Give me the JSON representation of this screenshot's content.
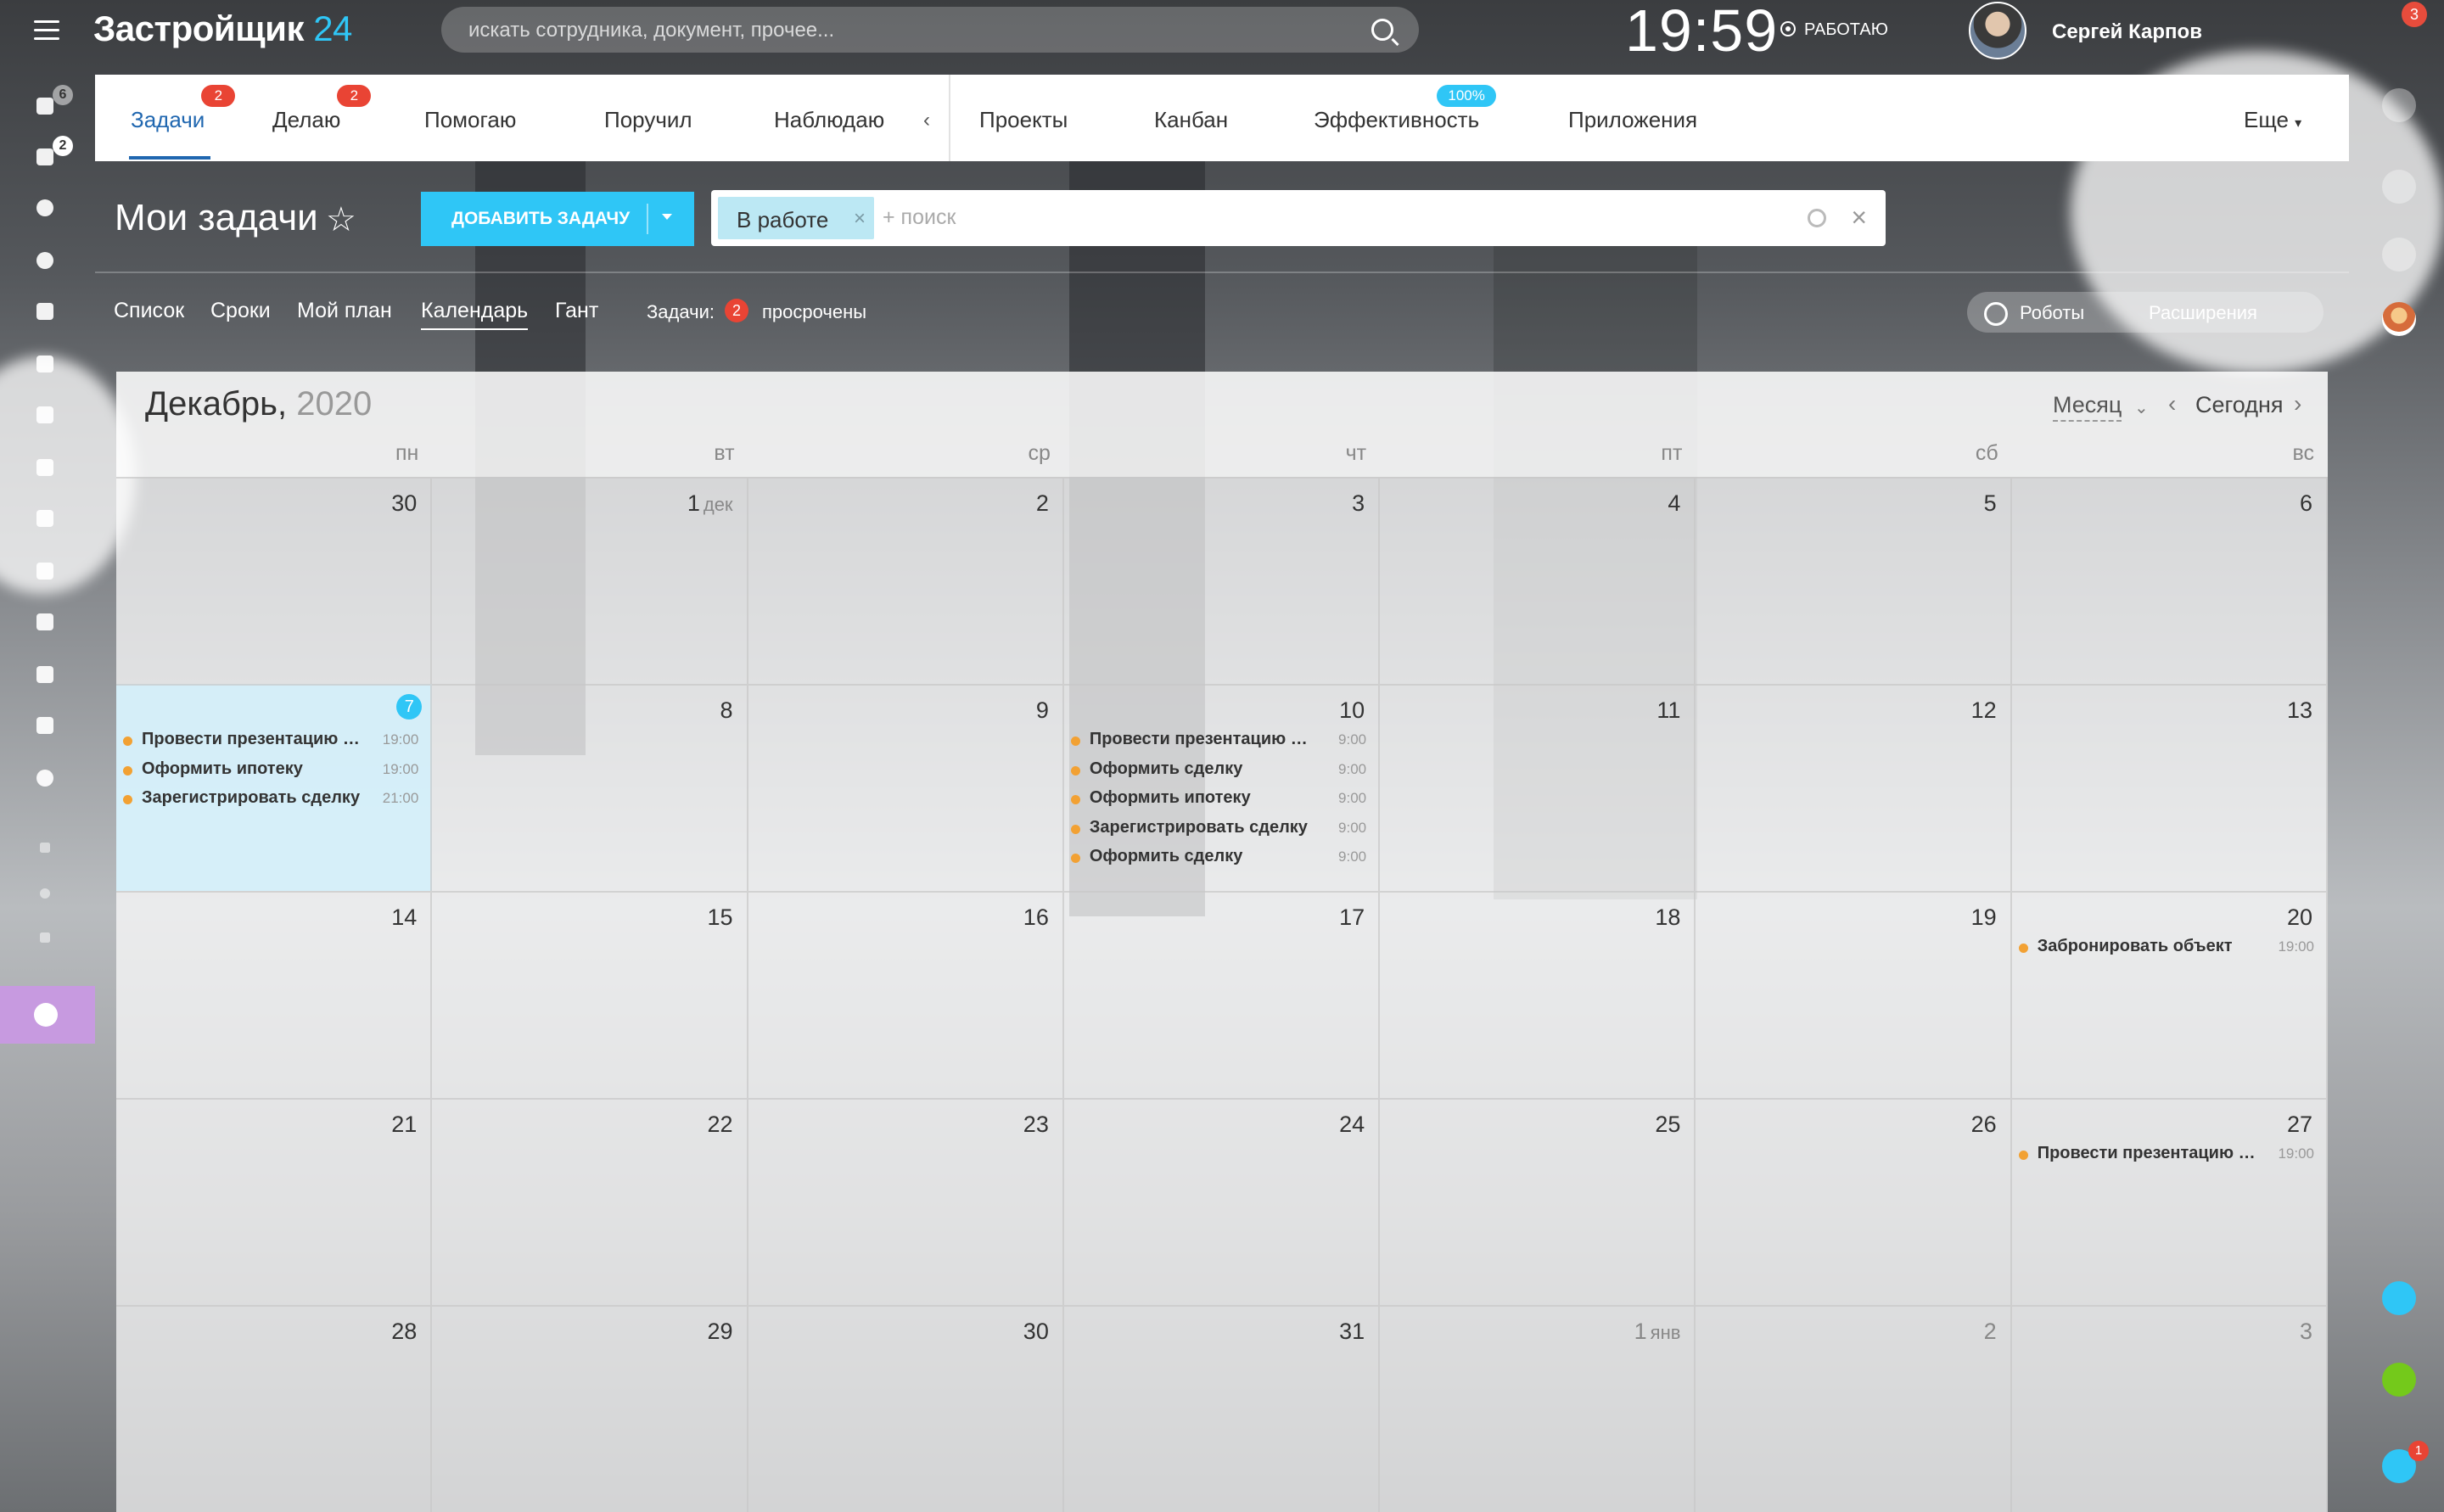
{
  "header": {
    "logo_main": "Застройщик",
    "logo_num": "24",
    "search_placeholder": "искать сотрудника, документ, прочее...",
    "clock": "19:59",
    "work_status": "РАБОТАЮ",
    "user_name": "Сергей Карпов",
    "notifications": "3"
  },
  "sidebar": {
    "badges": {
      "stream": "6",
      "tasks": "2"
    }
  },
  "tabs": [
    {
      "label": "Задачи",
      "badge": "2"
    },
    {
      "label": "Делаю",
      "badge": "2"
    },
    {
      "label": "Помогаю"
    },
    {
      "label": "Поручил"
    },
    {
      "label": "Наблюдаю"
    },
    {
      "label": "Проекты"
    },
    {
      "label": "Канбан"
    },
    {
      "label": "Эффективность",
      "badge": "100%"
    },
    {
      "label": "Приложения"
    },
    {
      "label": "Еще"
    }
  ],
  "toolbar": {
    "page_title": "Мои задачи",
    "add_button": "ДОБАВИТЬ ЗАДАЧУ",
    "filter_chip": "В работе",
    "filter_placeholder": "+ поиск"
  },
  "views": {
    "items": [
      "Список",
      "Сроки",
      "Мой план",
      "Календарь",
      "Гант"
    ],
    "counter_label": "Задачи:",
    "counter_value": "2",
    "counter_text": "просрочены",
    "robots": "Роботы",
    "extensions": "Расширения"
  },
  "calendar": {
    "month": "Декабрь,",
    "year": "2020",
    "mode": "Месяц",
    "today_label": "Сегодня",
    "weekdays": [
      "пн",
      "вт",
      "ср",
      "чт",
      "пт",
      "сб",
      "вс"
    ],
    "weeks": [
      [
        {
          "d": "30"
        },
        {
          "d": "1",
          "m": "дек"
        },
        {
          "d": "2"
        },
        {
          "d": "3"
        },
        {
          "d": "4"
        },
        {
          "d": "5"
        },
        {
          "d": "6"
        }
      ],
      [
        {
          "d": "7",
          "today": true,
          "events": [
            {
              "name": "Провести презентацию о...",
              "time": "19:00"
            },
            {
              "name": "Оформить ипотеку",
              "time": "19:00"
            },
            {
              "name": "Зарегистрировать сделку",
              "time": "21:00"
            }
          ]
        },
        {
          "d": "8"
        },
        {
          "d": "9"
        },
        {
          "d": "10",
          "events": [
            {
              "name": "Провести презентацию он...",
              "time": "9:00"
            },
            {
              "name": "Оформить сделку",
              "time": "9:00"
            },
            {
              "name": "Оформить ипотеку",
              "time": "9:00"
            },
            {
              "name": "Зарегистрировать сделку",
              "time": "9:00"
            },
            {
              "name": "Оформить сделку",
              "time": "9:00"
            }
          ]
        },
        {
          "d": "11"
        },
        {
          "d": "12"
        },
        {
          "d": "13"
        }
      ],
      [
        {
          "d": "14"
        },
        {
          "d": "15"
        },
        {
          "d": "16"
        },
        {
          "d": "17"
        },
        {
          "d": "18"
        },
        {
          "d": "19"
        },
        {
          "d": "20",
          "events": [
            {
              "name": "Забронировать объект",
              "time": "19:00"
            }
          ]
        }
      ],
      [
        {
          "d": "21"
        },
        {
          "d": "22"
        },
        {
          "d": "23"
        },
        {
          "d": "24"
        },
        {
          "d": "25"
        },
        {
          "d": "26"
        },
        {
          "d": "27",
          "events": [
            {
              "name": "Провести презентацию о...",
              "time": "19:00"
            }
          ]
        }
      ],
      [
        {
          "d": "28"
        },
        {
          "d": "29"
        },
        {
          "d": "30"
        },
        {
          "d": "31"
        },
        {
          "d": "1",
          "m": "янв",
          "other": true
        },
        {
          "d": "2",
          "other": true
        },
        {
          "d": "3",
          "other": true
        }
      ]
    ]
  },
  "rightbar": {
    "edu_badge": "1"
  }
}
